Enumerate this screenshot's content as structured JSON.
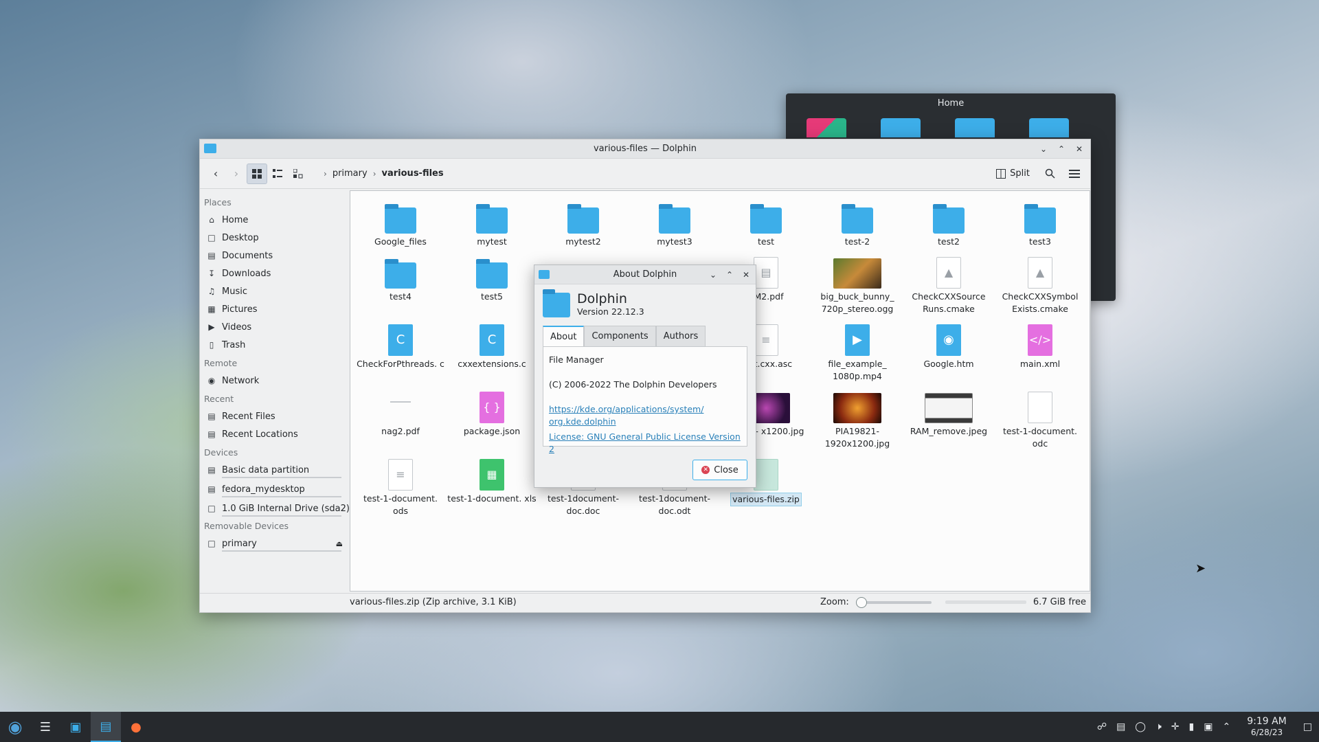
{
  "bg_window": {
    "title": "Home"
  },
  "window": {
    "title": "various-files — Dolphin",
    "breadcrumb": [
      "primary",
      "various-files"
    ],
    "split_label": "Split"
  },
  "places": {
    "sections": {
      "places": "Places",
      "remote": "Remote",
      "recent": "Recent",
      "devices": "Devices",
      "removable": "Removable Devices"
    },
    "places_items": [
      "Home",
      "Desktop",
      "Documents",
      "Downloads",
      "Music",
      "Pictures",
      "Videos",
      "Trash"
    ],
    "remote_items": [
      "Network"
    ],
    "recent_items": [
      "Recent Files",
      "Recent Locations"
    ],
    "device_items": [
      "Basic data partition",
      "fedora_mydesktop",
      "1.0 GiB Internal Drive (sda2)"
    ],
    "removable_items": [
      "primary"
    ]
  },
  "files": [
    {
      "name": "Google_files"
    },
    {
      "name": "mytest"
    },
    {
      "name": "mytest2"
    },
    {
      "name": "mytest3"
    },
    {
      "name": "test"
    },
    {
      "name": "test-2"
    },
    {
      "name": "test2"
    },
    {
      "name": "test3"
    },
    {
      "name": "test4"
    },
    {
      "name": "test5"
    },
    {
      "name": "0M2.pdf"
    },
    {
      "name": "big_buck_bunny_ 720p_stereo.ogg"
    },
    {
      "name": "CheckCXXSource Runs.cmake"
    },
    {
      "name": "CheckCXXSymbol Exists.cmake"
    },
    {
      "name": "CheckForPthreads. c"
    },
    {
      "name": "cxxextensions.c"
    },
    {
      "name": "port.cxx.asc"
    },
    {
      "name": "file_example_ 1080p.mp4"
    },
    {
      "name": "Google.htm"
    },
    {
      "name": "main.xml"
    },
    {
      "name": "nag2.pdf"
    },
    {
      "name": "package.json"
    },
    {
      "name": "17563- x1200.jpg"
    },
    {
      "name": "PIA19821- 1920x1200.jpg"
    },
    {
      "name": "RAM_remove.jpeg"
    },
    {
      "name": "test-1-document. odc"
    },
    {
      "name": "test-1-document. ods"
    },
    {
      "name": "test-1-document. xls"
    },
    {
      "name": "test-1document- doc.doc"
    },
    {
      "name": "test-1document- doc.odt"
    },
    {
      "name": "various-files.zip"
    }
  ],
  "status": {
    "selection": "various-files.zip (Zip archive, 3.1 KiB)",
    "zoom_label": "Zoom:",
    "zoom_level": 0.0,
    "free_space": "6.7 GiB free"
  },
  "about": {
    "title": "About Dolphin",
    "app_name": "Dolphin",
    "version": "Version 22.12.3",
    "tabs": [
      "About",
      "Components",
      "Authors"
    ],
    "description": "File Manager",
    "copyright": "(C) 2006-2022 The Dolphin Developers",
    "link_line1": "https://kde.org/applications/system/",
    "link_line2": "org.kde.dolphin",
    "license": "License: GNU General Public License Version 2",
    "close_label": "Close"
  },
  "taskbar": {
    "time": "9:19 AM",
    "date": "6/28/23"
  },
  "colors": {
    "accent": "#3daee9",
    "window_bg": "#eff0f1",
    "view_bg": "#fcfcfc",
    "taskbar_bg": "#26292d",
    "link": "#2980b9"
  }
}
